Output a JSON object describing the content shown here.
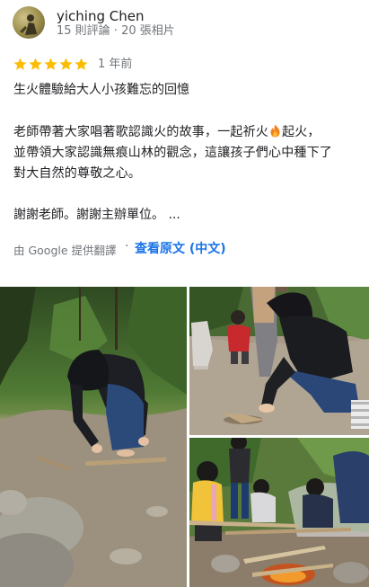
{
  "author": {
    "name": "yiching Chen",
    "meta": "15 則評論 · 20 張相片"
  },
  "rating": {
    "stars": 5,
    "max_stars": 5,
    "star_color": "#fbbc04",
    "time_ago": "1 年前"
  },
  "review": {
    "title": "生火體驗給大人小孩難忘的回憶",
    "line1_before_icon": "老師帶著大家唱著歌認識火的故事，一起祈火",
    "line1_after_icon": "起火，",
    "line2": "並帶領大家認識無痕山林的觀念，這讓孩子們心中種下了",
    "line3": "對大自然的尊敬之心。",
    "thanks": "謝謝老師。謝謝主辦單位。 ...",
    "inline_icon": "fire-icon"
  },
  "translation": {
    "note": "由 Google 提供翻譯",
    "separator": "·",
    "view_original": "查看原文 (中文)",
    "link_color": "#1a73e8"
  },
  "photos": [
    {
      "name": "review-photo-1"
    },
    {
      "name": "review-photo-2"
    },
    {
      "name": "review-photo-3"
    }
  ]
}
